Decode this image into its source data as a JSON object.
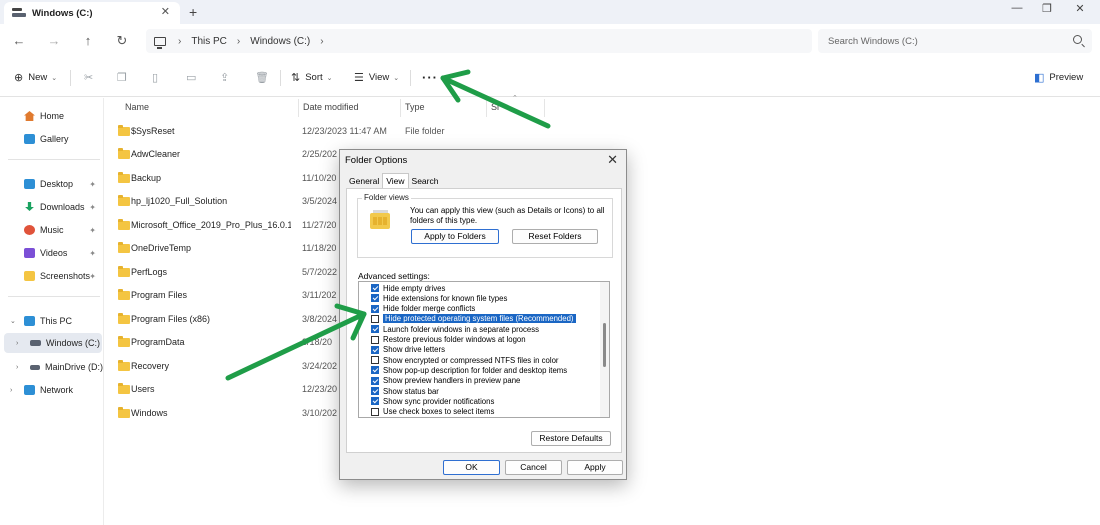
{
  "window": {
    "tab_title": "Windows (C:)",
    "tab_close": "✕",
    "new_tab": "+",
    "minimize": "—",
    "maximize": "❐",
    "close": "✕"
  },
  "nav": {
    "back": "←",
    "forward": "→",
    "up": "↑",
    "refresh": "↻"
  },
  "address": {
    "sep": "›",
    "crumbs": [
      "This PC",
      "Windows (C:)"
    ],
    "search_placeholder": "Search Windows (C:)"
  },
  "toolbar": {
    "new_label": "New",
    "sort_label": "Sort",
    "view_label": "View",
    "more_label": "···",
    "preview_label": "Preview",
    "icons": [
      "cut-icon",
      "copy-icon",
      "paste-icon",
      "rename-icon",
      "share-icon",
      "delete-icon"
    ]
  },
  "sidebar": {
    "items": [
      {
        "label": "Home",
        "icon": "home-icon",
        "color": "#e07a2f"
      },
      {
        "label": "Gallery",
        "icon": "gallery-icon",
        "color": "#2d8fd5"
      },
      {
        "label": "Desktop",
        "icon": "desktop-icon",
        "color": "#2d8fd5",
        "pinned": true
      },
      {
        "label": "Downloads",
        "icon": "download-icon",
        "color": "#1aa260",
        "pinned": true
      },
      {
        "label": "Music",
        "icon": "music-icon",
        "color": "#e0533a",
        "pinned": true
      },
      {
        "label": "Videos",
        "icon": "video-icon",
        "color": "#7b4fd6",
        "pinned": true
      },
      {
        "label": "Screenshots",
        "icon": "folder-icon",
        "color": "#f4c542",
        "pinned": true
      },
      {
        "label": "This PC",
        "icon": "monitor-icon",
        "color": "#2d8fd5"
      },
      {
        "label": "Windows (C:)",
        "icon": "drive-icon",
        "color": "#5a6270"
      },
      {
        "label": "MainDrive (D:)",
        "icon": "drive-icon",
        "color": "#5a6270"
      },
      {
        "label": "Network",
        "icon": "network-icon",
        "color": "#2d8fd5"
      }
    ],
    "pin_glyph": "📌",
    "expand_open": "⌄",
    "expand_closed": "›"
  },
  "filelist": {
    "columns": [
      "Name",
      "Date modified",
      "Type",
      "Si"
    ],
    "rows": [
      {
        "name": "$SysReset",
        "date": "12/23/2023 11:47 AM",
        "type": "File folder"
      },
      {
        "name": "AdwCleaner",
        "date": "2/25/202",
        "type": ""
      },
      {
        "name": "Backup",
        "date": "11/10/20",
        "type": ""
      },
      {
        "name": "hp_lj1020_Full_Solution",
        "date": "3/5/2024",
        "type": ""
      },
      {
        "name": "Microsoft_Office_2019_Pro_Plus_16.0.103...",
        "date": "11/27/20",
        "type": ""
      },
      {
        "name": "OneDriveTemp",
        "date": "11/18/20",
        "type": ""
      },
      {
        "name": "PerfLogs",
        "date": "5/7/2022",
        "type": ""
      },
      {
        "name": "Program Files",
        "date": "3/11/202",
        "type": ""
      },
      {
        "name": "Program Files (x86)",
        "date": "3/8/2024",
        "type": ""
      },
      {
        "name": "ProgramData",
        "date": "3/18/20",
        "type": ""
      },
      {
        "name": "Recovery",
        "date": "3/24/202",
        "type": ""
      },
      {
        "name": "Users",
        "date": "12/23/20",
        "type": ""
      },
      {
        "name": "Windows",
        "date": "3/10/202",
        "type": ""
      }
    ]
  },
  "dialog": {
    "title": "Folder Options",
    "close": "✕",
    "tabs": [
      "General",
      "View",
      "Search"
    ],
    "folder_views_legend": "Folder views",
    "folder_views_desc": "You can apply this view (such as Details or Icons) to all folders of this type.",
    "apply_to_folders": "Apply to Folders",
    "reset_folders": "Reset Folders",
    "advanced_label": "Advanced settings:",
    "advanced_items": [
      {
        "label": "Hide empty drives",
        "checked": true
      },
      {
        "label": "Hide extensions for known file types",
        "checked": true
      },
      {
        "label": "Hide folder merge conflicts",
        "checked": true
      },
      {
        "label": "Hide protected operating system files (Recommended)",
        "checked": false,
        "highlighted": true
      },
      {
        "label": "Launch folder windows in a separate process",
        "checked": true
      },
      {
        "label": "Restore previous folder windows at logon",
        "checked": false
      },
      {
        "label": "Show drive letters",
        "checked": true
      },
      {
        "label": "Show encrypted or compressed NTFS files in color",
        "checked": false
      },
      {
        "label": "Show pop-up description for folder and desktop items",
        "checked": true
      },
      {
        "label": "Show preview handlers in preview pane",
        "checked": true
      },
      {
        "label": "Show status bar",
        "checked": true
      },
      {
        "label": "Show sync provider notifications",
        "checked": true
      },
      {
        "label": "Use check boxes to select items",
        "checked": false
      }
    ],
    "restore_defaults": "Restore Defaults",
    "ok": "OK",
    "cancel": "Cancel",
    "apply": "Apply"
  },
  "colors": {
    "accent": "#1a66c4",
    "annotation_arrow": "#1f9d48",
    "folder": "#f4c542"
  }
}
